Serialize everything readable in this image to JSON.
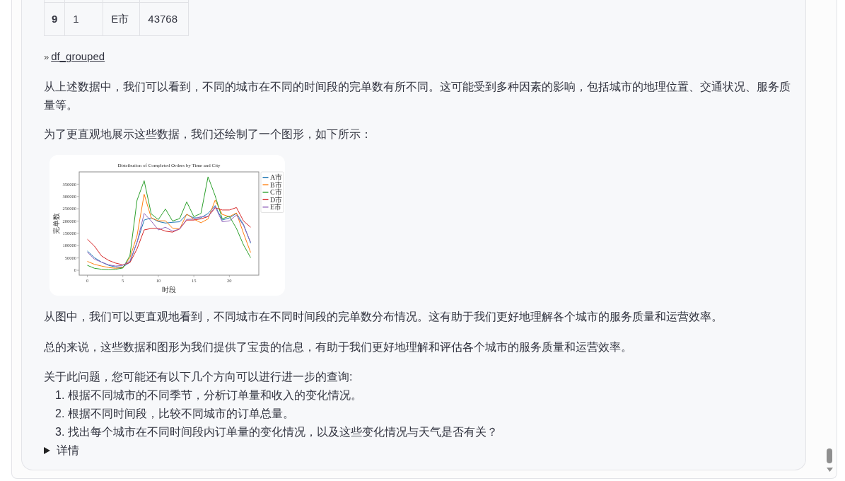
{
  "table": {
    "rows": [
      {
        "cells": [
          "9",
          "1",
          "E市",
          "43768"
        ]
      }
    ]
  },
  "link": {
    "marker": "»",
    "label": "df_grouped"
  },
  "paragraphs_before_chart": [
    "从上述数据中，我们可以看到，不同的城市在不同的时间段的完单数有所不同。这可能受到多种因素的影响，包括城市的地理位置、交通状况、服务质量等。",
    "为了更直观地展示这些数据，我们还绘制了一个图形，如下所示："
  ],
  "chart": {
    "chart_data": {
      "type": "line",
      "title": "Distribution of Completed Orders by Time and City",
      "xlabel": "时段",
      "ylabel": "完单数",
      "x": [
        0,
        1,
        2,
        3,
        4,
        5,
        6,
        7,
        8,
        9,
        10,
        11,
        12,
        13,
        14,
        15,
        16,
        17,
        18,
        19,
        20,
        21,
        22,
        23
      ],
      "series": [
        {
          "name": "A市",
          "color": "#1f77b4",
          "values": [
            78000,
            51000,
            33000,
            20000,
            13000,
            13000,
            33000,
            114000,
            204000,
            213000,
            198000,
            192000,
            195000,
            197000,
            227000,
            213000,
            213000,
            231000,
            263000,
            204000,
            213000,
            231000,
            186000,
            110000
          ]
        },
        {
          "name": "B市",
          "color": "#ff7f0e",
          "values": [
            36000,
            24000,
            17000,
            11000,
            8000,
            11000,
            51000,
            141000,
            309000,
            213000,
            201000,
            201000,
            171000,
            168000,
            228000,
            208000,
            193000,
            209000,
            285000,
            227000,
            218000,
            233000,
            150000,
            72000
          ]
        },
        {
          "name": "C市",
          "color": "#2ca02c",
          "values": [
            20000,
            8000,
            4000,
            3000,
            4000,
            9000,
            60000,
            285000,
            364000,
            229000,
            206000,
            249000,
            200000,
            210000,
            278000,
            218000,
            231000,
            380000,
            303000,
            209000,
            220000,
            170000,
            103000,
            51000
          ]
        },
        {
          "name": "D市",
          "color": "#d62728",
          "values": [
            126000,
            98000,
            58000,
            40000,
            29000,
            22000,
            31000,
            87000,
            164000,
            170000,
            170000,
            159000,
            155000,
            168000,
            204000,
            204000,
            209000,
            218000,
            254000,
            245000,
            245000,
            255000,
            200000,
            175000
          ]
        },
        {
          "name": "E市",
          "color": "#9467bd",
          "values": [
            74000,
            45000,
            33000,
            22000,
            17000,
            20000,
            38000,
            114000,
            231000,
            200000,
            164000,
            175000,
            159000,
            168000,
            207000,
            208000,
            218000,
            219000,
            258000,
            197000,
            201000,
            224000,
            182000,
            114000
          ]
        }
      ],
      "xlim": [
        -1.15,
        24.15
      ],
      "ylim": [
        -20000,
        400000
      ],
      "xticks": [
        0,
        5,
        10,
        15,
        20
      ],
      "yticks": [
        0,
        50000,
        100000,
        150000,
        200000,
        250000,
        300000,
        350000
      ],
      "legend": true
    }
  },
  "paragraphs_after_chart": [
    "从图中，我们可以更直观地看到，不同城市在不同时间段的完单数分布情况。这有助于我们更好地理解各个城市的服务质量和运营效率。",
    "总的来说，这些数据和图形为我们提供了宝贵的信息，有助于我们更好地理解和评估各个城市的服务质量和运营效率。"
  ],
  "followup": {
    "intro": "关于此问题，您可能还有以下几个方向可以进行进一步的查询:",
    "items": [
      "1. 根据不同城市的不同季节，分析订单量和收入的变化情况。",
      "2. 根据不同时间段，比较不同城市的订单总量。",
      "3. 找出每个城市在不同时间段内订单量的变化情况，以及这些变化情况与天气是否有关？"
    ]
  },
  "details": {
    "label": "详情",
    "expanded": false
  }
}
